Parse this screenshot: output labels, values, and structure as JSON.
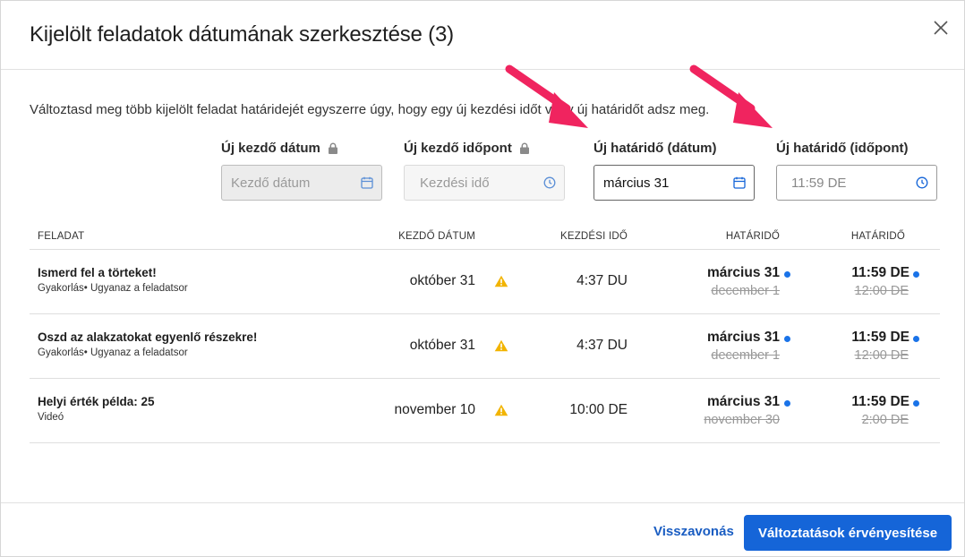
{
  "dialog": {
    "title": "Kijelölt feladatok dátumának szerkesztése (3)",
    "intro": "Változtasd meg több kijelölt feladat határidejét egyszerre úgy, hogy egy új kezdési időt vagy új határidőt adsz meg."
  },
  "fields": {
    "start_date": {
      "label": "Új kezdő dátum",
      "placeholder": "Kezdő dátum",
      "locked": true
    },
    "start_time": {
      "label": "Új kezdő időpont",
      "placeholder": "Kezdési idő",
      "locked": true
    },
    "due_date": {
      "label": "Új határidő (dátum)",
      "value": "március 31"
    },
    "due_time": {
      "label": "Új határidő (időpont)",
      "placeholder": "11:59 DE"
    }
  },
  "table": {
    "headers": {
      "task": "FELADAT",
      "start_date": "KEZDŐ DÁTUM",
      "start_time": "KEZDÉSI IDŐ",
      "due_date": "HATÁRIDŐ",
      "due_time": "HATÁRIDŐ"
    },
    "rows": [
      {
        "name": "Ismerd fel a törteket!",
        "sub": "Gyakorlás• Ugyanaz a feladatsor",
        "start_date": "október 31",
        "start_time": "4:37 DU",
        "due_new": "március 31",
        "due_old": "december 1",
        "time_new": "11:59 DE",
        "time_old": "12:00 DE"
      },
      {
        "name": "Oszd az alakzatokat egyenlő részekre!",
        "sub": "Gyakorlás• Ugyanaz a feladatsor",
        "start_date": "október 31",
        "start_time": "4:37 DU",
        "due_new": "március 31",
        "due_old": "december 1",
        "time_new": "11:59 DE",
        "time_old": "12:00 DE"
      },
      {
        "name": "Helyi érték példa: 25",
        "sub": "Videó",
        "start_date": "november 10",
        "start_time": "10:00 DE",
        "due_new": "március 31",
        "due_old": "november 30",
        "time_new": "11:59 DE",
        "time_old": "2:00 DE"
      }
    ]
  },
  "footer": {
    "cancel_label": "Visszavonás",
    "apply_label": "Változtatások érvényesítése"
  },
  "colors": {
    "accent": "#1565d8",
    "warning": "#f2b400",
    "annotation_arrow": "#f0245f"
  },
  "icons": [
    "close-icon",
    "lock-icon",
    "calendar-icon",
    "clock-icon",
    "warning-icon",
    "changed-dot-icon"
  ]
}
